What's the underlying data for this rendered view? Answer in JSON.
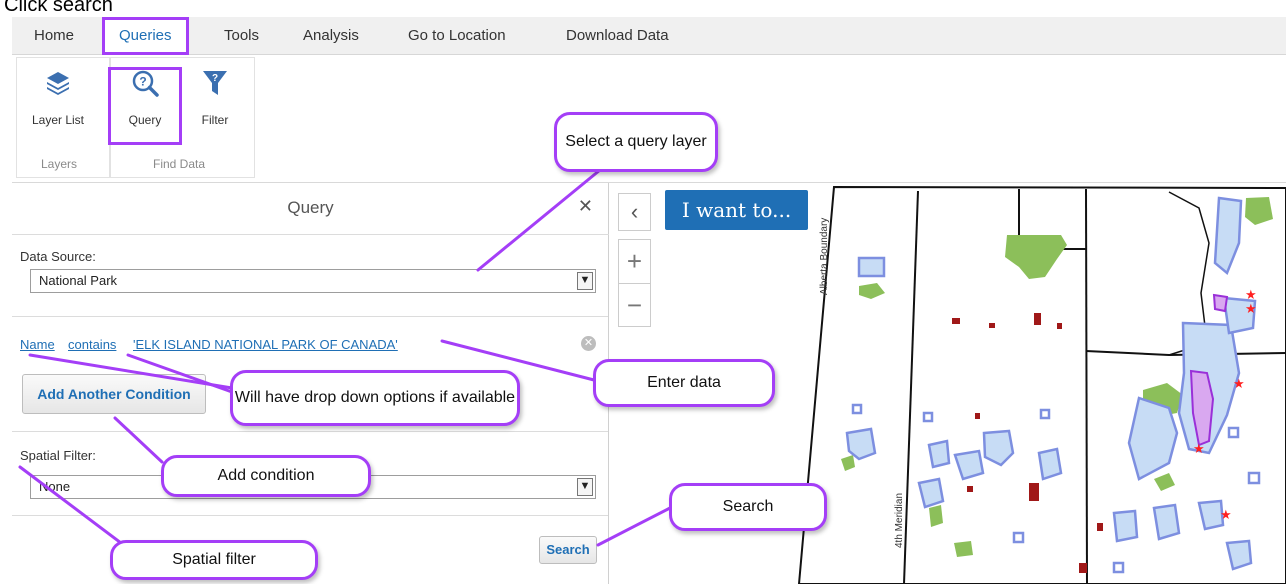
{
  "caption": "Click search",
  "menu": {
    "tabs": [
      {
        "label": "Home"
      },
      {
        "label": "Queries"
      },
      {
        "label": "Tools"
      },
      {
        "label": "Analysis"
      },
      {
        "label": "Go to Location"
      },
      {
        "label": "Download Data"
      }
    ],
    "active_tab": "Queries"
  },
  "ribbon": {
    "groups": [
      {
        "label": "Layers",
        "buttons": [
          {
            "label": "Layer List",
            "icon": "layers-icon"
          }
        ]
      },
      {
        "label": "Find Data",
        "buttons": [
          {
            "label": "Query",
            "icon": "query-icon"
          },
          {
            "label": "Filter",
            "icon": "filter-icon"
          }
        ]
      }
    ]
  },
  "panel": {
    "title": "Query",
    "close_icon": "close-icon",
    "data_source_label": "Data Source:",
    "data_source_value": "National Park",
    "condition": {
      "field": "Name",
      "operator": "contains",
      "value": "'ELK ISLAND NATIONAL PARK OF CANADA'"
    },
    "add_condition_label": "Add Another Condition",
    "spatial_filter_label": "Spatial Filter:",
    "spatial_filter_value": "None",
    "search_label": "Search"
  },
  "map": {
    "collapse_icon": "chevron-left-icon",
    "i_want_to_label": "I want to...",
    "zoom_in_icon": "plus-icon",
    "zoom_out_icon": "minus-icon",
    "labels": {
      "boundary": "Alberta Boundary",
      "meridian": "4th Meridian"
    },
    "colors": {
      "park_green": "#8cbf5a",
      "reserve_blue": "#c7dcf5",
      "reserve_outline": "#7d8fe0",
      "brown": "#a01818",
      "star": "#ff2020"
    }
  },
  "callouts": {
    "select_layer": "Select a query layer",
    "enter_data": "Enter data",
    "dropdown_options": "Will have drop down options if available",
    "add_condition": "Add condition",
    "search": "Search",
    "spatial_filter": "Spatial filter"
  },
  "colors": {
    "accent_purple": "#a43ef7",
    "link_blue": "#1f6fb5",
    "menubar_bg": "#f0f0f0"
  }
}
